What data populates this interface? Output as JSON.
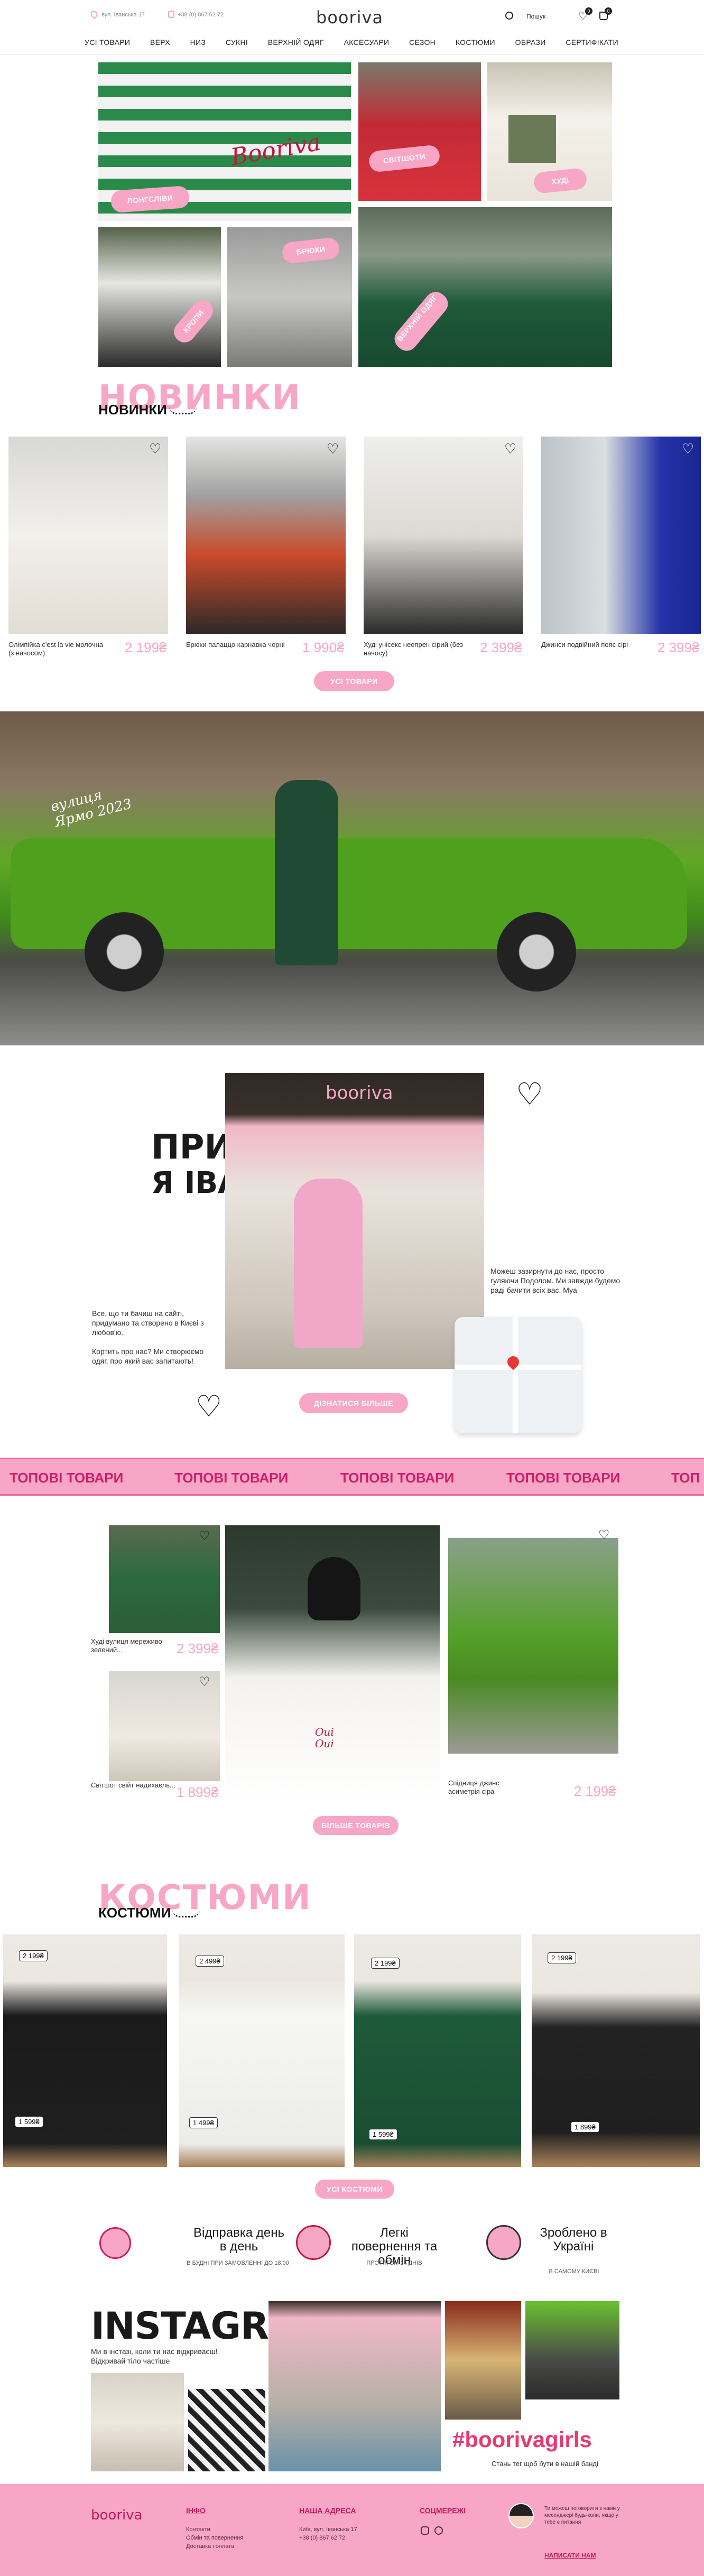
{
  "header": {
    "address": "вул. Іванська 17",
    "phone": "+38 (0) 867 62 72",
    "logo": "booriva",
    "search_label": "Пошук",
    "wishlist_count": "0",
    "cart_count": "0",
    "nav": [
      "УСІ ТОВАРИ",
      "ВЕРХ",
      "НИЗ",
      "СУКНІ",
      "ВЕРХНІЙ ОДЯГ",
      "АКСЕСУАРИ",
      "СЕЗОН",
      "КОСТЮМИ",
      "ОБРАЗИ",
      "СЕРТИФІКАТИ"
    ]
  },
  "hero": {
    "tiles": [
      "ЛОНГСЛІВИ",
      "СВІТШОТИ",
      "ХУДІ",
      "КРОПИ",
      "БРЮКИ",
      "ВЕРХНІЙ ОДЯГ"
    ],
    "shirt_text": "Booriva"
  },
  "novelties": {
    "title_big": "НОВИНКИ",
    "title": "НОВИНКИ",
    "products": [
      {
        "name": "Олімпійка c'est la vie молочна (з начосом)",
        "price": "2 199₴"
      },
      {
        "name": "Брюки палаццо карнавка чорні",
        "price": "1 990₴"
      },
      {
        "name": "Худі унісекс неопрен сірий (без начосу)",
        "price": "2 399₴"
      },
      {
        "name": "Джинси подвійний пояс сірі",
        "price": "2 399₴"
      }
    ],
    "all_button": "УСІ ТОВАРИ"
  },
  "banner": {
    "script_text": "вулиця Ярмо 2023"
  },
  "about": {
    "title_line1": "ПРИВІТ",
    "title_line2": "Я ІВАНКА",
    "store_sign": "booriva",
    "text_left_1": "Все, що ти бачиш на сайті, придумано та створено в Києві з любов'ю.",
    "text_left_2": "Кортить про нас? Ми створюємо одяг, про який вас запитають!",
    "text_right": "Можеш зазирнути до нас, просто гуляючи Подолом. Ми завжди будемо раді бачити всіх вас. Муа",
    "button": "ДІЗНАТИСЯ БІЛЬШЕ"
  },
  "marquee": {
    "items": [
      "ТОПОВІ ТОВАРИ",
      "ТОПОВІ ТОВАРИ",
      "ТОПОВІ ТОВАРИ",
      "ТОПОВІ ТОВАРИ",
      "ТОП"
    ]
  },
  "top_products": {
    "products": [
      {
        "name": "Худі вулиця мереживо зелений...",
        "price": "2 399₴"
      },
      {
        "name": "Світшот свійт надихаєль...",
        "price": "1 899₴"
      },
      {
        "name": "Спідниця джинс асиметрія сіра",
        "price": "2 199₴"
      }
    ],
    "center_shirt_text": "Oui Oui",
    "button": "БІЛЬШЕ ТОВАРІВ"
  },
  "suits": {
    "title_big": "КОСТЮМИ",
    "title": "КОСТЮМИ",
    "items": [
      {
        "price_top": "2 199₴",
        "price_bottom": "1 599₴"
      },
      {
        "price_top": "2 499₴",
        "price_bottom": "1 499₴"
      },
      {
        "price_top": "2 199₴",
        "price_bottom": "1 599₴"
      },
      {
        "price_top": "2 199₴",
        "price_bottom": "1 899₴"
      }
    ],
    "button": "УСІ КОСТЮМИ"
  },
  "features": [
    {
      "title": "Відправка день в день",
      "sub": "В БУДНІ ПРИ ЗАМОВЛЕННІ ДО 18:00"
    },
    {
      "title": "Легкі повернення та обмін",
      "sub": "ПРОТЯГОМ 14 ДНІВ"
    },
    {
      "title": "Зроблено в Україні",
      "sub": "В САМОМУ КИЄВІ"
    }
  ],
  "instagram": {
    "title": "INSTAGRAM",
    "sub": "Ми в інстазі, коли ти нас відкриваєш! Відкривай тіло частіше",
    "hashtag": "#boorivagirls",
    "hashtag_sub": "Стань тег щоб бути в нашій банді"
  },
  "footer": {
    "logo": "booriva",
    "col1_title": "ІНФО",
    "col1": [
      "Контакти",
      "Обмін та повернення",
      "Доставка і оплата"
    ],
    "col2_title": "НАША АДРЕСА",
    "col2": [
      "Київ, вул. Іванська 17",
      "+38 (0) 867 62 72"
    ],
    "col3_title": "СОЦМЕРЕЖІ",
    "promo_text": "Ти можеш поговорити з нами у месенджері будь-коли, якщо у тебе є питання",
    "promo_link": "НАПИСАТИ НАМ"
  },
  "colors": {
    "accent": "#f7a6c6",
    "accent_dark": "#d01d6a"
  }
}
